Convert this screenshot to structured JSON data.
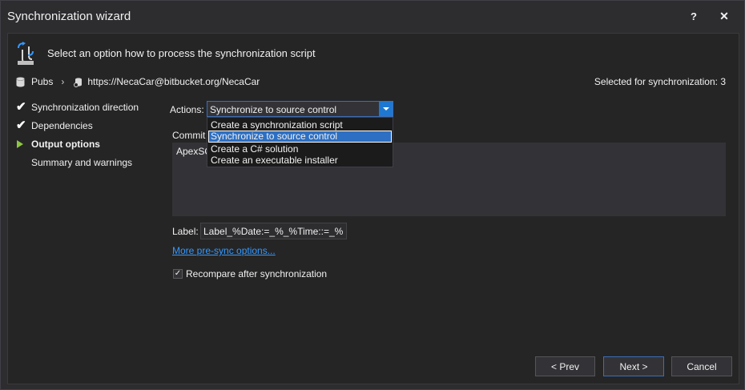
{
  "window": {
    "title": "Synchronization wizard",
    "help_label": "?",
    "close_label": "✕"
  },
  "header": {
    "prompt": "Select an option how to process the synchronization script"
  },
  "source": {
    "database": "Pubs",
    "repository": "https://NecaCar@bitbucket.org/NecaCar",
    "selected_count": "Selected for synchronization: 3"
  },
  "steps": [
    {
      "label": "Synchronization direction",
      "state": "done"
    },
    {
      "label": "Dependencies",
      "state": "done"
    },
    {
      "label": "Output options",
      "state": "active"
    },
    {
      "label": "Summary and warnings",
      "state": "pending"
    }
  ],
  "actions": {
    "label": "Actions:",
    "selected": "Synchronize to source control",
    "options": [
      "Create a synchronization script",
      "Synchronize to source control",
      "Create a C# solution",
      "Create an executable installer"
    ]
  },
  "commit": {
    "label": "Commit c",
    "value": "ApexSQ"
  },
  "label_field": {
    "label": "Label:",
    "value": "Label_%Date:=_%_%Time::=_%"
  },
  "more_link": "More pre-sync options...",
  "recompare": {
    "label": "Recompare after synchronization",
    "checked": true
  },
  "buttons": {
    "prev": "< Prev",
    "next": "Next >",
    "cancel": "Cancel"
  },
  "colors": {
    "accent": "#1e78d2",
    "step_active": "#8dc63f",
    "link": "#3399ff"
  }
}
